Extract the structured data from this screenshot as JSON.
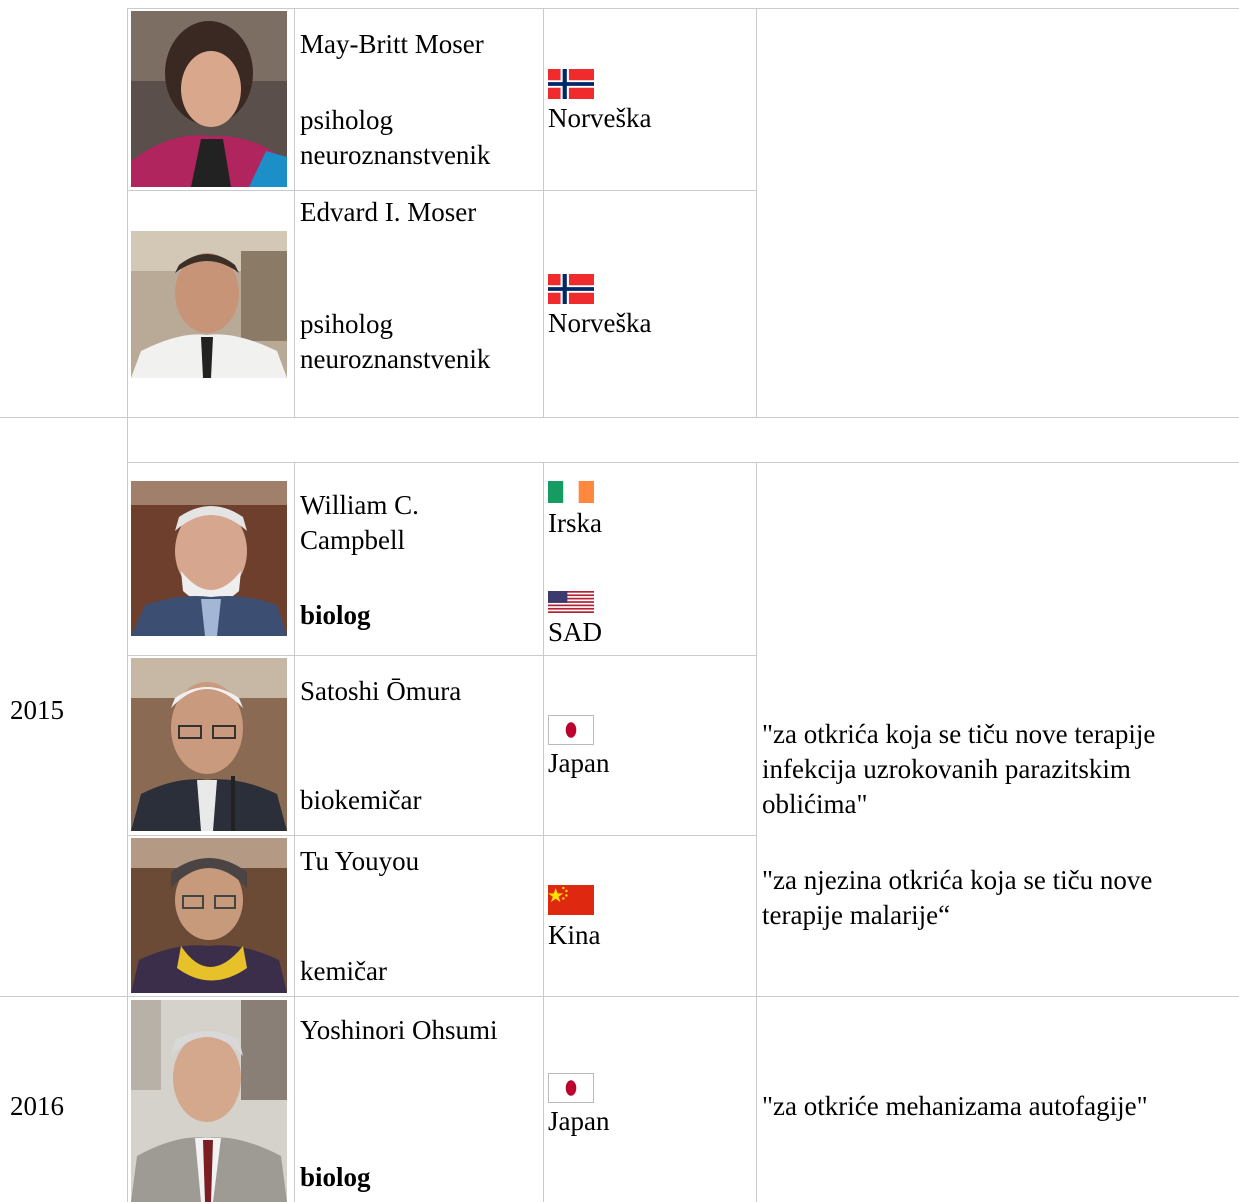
{
  "rows": {
    "r2014": {
      "laureates": [
        {
          "name": "May-Britt Moser",
          "profession_line1": "psiholog",
          "profession_line2": "neuroznanstvenik",
          "countries": [
            "Norveška"
          ]
        },
        {
          "name": "Edvard I. Moser",
          "profession_line1": "psiholog",
          "profession_line2": "neuroznanstvenik",
          "countries": [
            "Norveška"
          ]
        }
      ]
    },
    "r2015": {
      "year": "2015",
      "laureates": [
        {
          "name_line1": "William C.",
          "name_line2": "Campbell",
          "profession": "biolog",
          "countries": [
            "Irska",
            "SAD"
          ]
        },
        {
          "name": "Satoshi Ōmura",
          "profession": "biokemičar",
          "countries": [
            "Japan"
          ]
        },
        {
          "name": "Tu Youyou",
          "profession": "kemičar",
          "countries": [
            "Kina"
          ]
        }
      ],
      "citation1": [
        "\"za otkrića koja se tiču nove terapije",
        "infekcija uzrokovanih parazitskim",
        "oblićima\""
      ],
      "citation2": [
        "\"za njezina otkrića koja se tiču nove",
        "terapije malarije“"
      ]
    },
    "r2016": {
      "year": "2016",
      "laureates": [
        {
          "name": "Yoshinori Ohsumi",
          "profession": "biolog",
          "countries": [
            "Japan"
          ]
        }
      ],
      "citation": "\"za otkriće mehanizama autofagije\""
    }
  },
  "flags": {
    "norway": {
      "red": "#ef2b2d",
      "blue": "#002868",
      "white": "#ffffff"
    },
    "ireland": {
      "green": "#169b62",
      "white": "#ffffff",
      "orange": "#ff883e"
    },
    "usa": {
      "red": "#b22234",
      "white": "#ffffff",
      "blue": "#3c3b6e"
    },
    "japan": {
      "red": "#bc002d",
      "white": "#ffffff"
    },
    "china": {
      "red": "#de2910",
      "yellow": "#ffde00"
    }
  },
  "border_color": "#c8ccd1"
}
